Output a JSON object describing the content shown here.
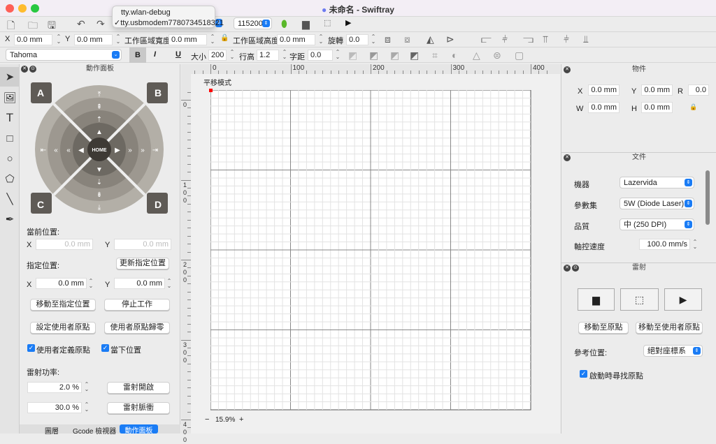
{
  "window": {
    "title": "未命名 - Swiftray"
  },
  "port_menu": {
    "items": [
      {
        "label": "tty.wlan-debug",
        "checked": false
      },
      {
        "label": "tty.usbmodem7780734518321",
        "checked": true
      }
    ]
  },
  "baud": "115200",
  "geometry": {
    "x_label": "X",
    "x": "0.0 mm",
    "y_label": "Y",
    "y": "0.0 mm",
    "width_label": "工作區域寬度",
    "width": "0.0 mm",
    "height_label": "工作區域高度",
    "height": "0.0 mm",
    "rotate_label": "旋轉",
    "rotate": "0.0"
  },
  "font": {
    "family": "Tahoma",
    "bold": "B",
    "italic": "I",
    "underline": "U",
    "size_label": "大小",
    "size": "200",
    "line_height_label": "行高",
    "line_height": "1.2",
    "spacing_label": "字距",
    "spacing": "0.0"
  },
  "jog": {
    "title": "動作面板",
    "corners": [
      "A",
      "B",
      "C",
      "D"
    ],
    "home": "HOME"
  },
  "left": {
    "current_pos": "當前位置:",
    "cx_label": "X",
    "cx": "0.0 mm",
    "cy_label": "Y",
    "cy": "0.0 mm",
    "target_pos": "指定位置:",
    "update_btn": "更新指定位置",
    "tx_label": "X",
    "tx": "0.0 mm",
    "ty_label": "Y",
    "ty": "0.0 mm",
    "move_btn": "移動至指定位置",
    "stop_btn": "停止工作",
    "set_origin_btn": "設定使用者原點",
    "zero_btn": "使用者原點歸零",
    "use_custom_origin": "使用者定義原點",
    "current_position": "當下位置",
    "laser_power": "雷射功率:",
    "power1": "2.0 %",
    "laser_on_btn": "雷射開啟",
    "power2": "30.0 %",
    "laser_pulse_btn": "雷射脈衝"
  },
  "bottom_tabs": [
    {
      "label": "圖層",
      "active": false
    },
    {
      "label": "Gcode 檢視器",
      "active": false
    },
    {
      "label": "動作面板",
      "active": true
    }
  ],
  "canvas": {
    "mode": "平移模式",
    "zoom": "15.9%",
    "zoom_minus": "−",
    "zoom_plus": "+",
    "ruler_x": [
      "0",
      "100",
      "200",
      "300",
      "400"
    ],
    "ruler_y": [
      "0",
      "100",
      "200",
      "300",
      "400"
    ],
    "origin_color": "#ff0000"
  },
  "object": {
    "title": "物件",
    "x_label": "X",
    "x": "0.0 mm",
    "y_label": "Y",
    "y": "0.0 mm",
    "r_label": "R",
    "r": "0.0",
    "w_label": "W",
    "w": "0.0 mm",
    "h_label": "H",
    "h": "0.0 mm"
  },
  "document": {
    "title": "文件",
    "machine_label": "機器",
    "machine": "Lazervida",
    "preset_label": "參數集",
    "preset": "5W (Diode Laser)",
    "quality_label": "品質",
    "quality": "中 (250 DPI)",
    "speed_label": "軸控速度",
    "speed": "100.0 mm/s"
  },
  "laser": {
    "title": "雷射",
    "home_btn": "移動至原點",
    "user_home_btn": "移動至使用者原點",
    "ref_label": "參考位置:",
    "ref": "絕對座標系",
    "find_home": "啟動時尋找原點"
  },
  "colors": {
    "accent": "#1a7cf5"
  }
}
